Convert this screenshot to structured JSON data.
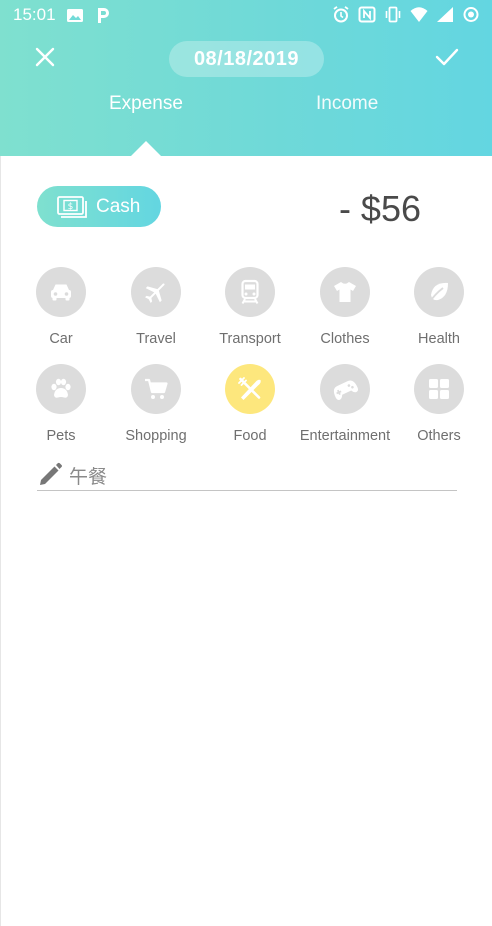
{
  "status_bar": {
    "time": "15:01",
    "left_icons": [
      "image-icon",
      "parking-icon"
    ],
    "right_icons": [
      "alarm-icon",
      "nfc-icon",
      "vibrate-icon",
      "wifi-icon",
      "signal-icon",
      "circle-icon"
    ]
  },
  "header": {
    "date": "08/18/2019",
    "tabs": [
      {
        "label": "Expense",
        "active": true
      },
      {
        "label": "Income",
        "active": false
      }
    ]
  },
  "account": {
    "label": "Cash",
    "icon": "banknote-icon"
  },
  "amount": "- $56",
  "categories": [
    {
      "label": "Car",
      "icon": "car-icon",
      "selected": false
    },
    {
      "label": "Travel",
      "icon": "airplane-icon",
      "selected": false
    },
    {
      "label": "Transport",
      "icon": "train-icon",
      "selected": false
    },
    {
      "label": "Clothes",
      "icon": "shirt-icon",
      "selected": false
    },
    {
      "label": "Health",
      "icon": "leaf-icon",
      "selected": false
    },
    {
      "label": "Pets",
      "icon": "paw-icon",
      "selected": false
    },
    {
      "label": "Shopping",
      "icon": "cart-icon",
      "selected": false
    },
    {
      "label": "Food",
      "icon": "utensils-icon",
      "selected": true
    },
    {
      "label": "Entertainment",
      "icon": "gamepad-icon",
      "selected": false
    },
    {
      "label": "Others",
      "icon": "grid-icon",
      "selected": false
    }
  ],
  "note": {
    "value": "午餐",
    "icon": "pencil-icon"
  },
  "colors": {
    "header_gradient_start": "#7fe0cf",
    "header_gradient_end": "#63d6e1",
    "selected_category": "#fde77d",
    "category_bg": "#dcdcdc"
  }
}
